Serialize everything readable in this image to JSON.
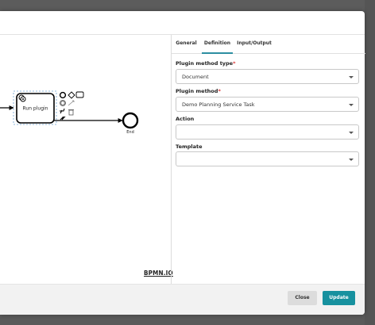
{
  "tabs": [
    {
      "label": "General"
    },
    {
      "label": "Definition",
      "active": true
    },
    {
      "label": "Input/Output"
    }
  ],
  "form": {
    "plugin_method_type": {
      "label": "Plugin method type",
      "required_mark": "*",
      "value": "Document"
    },
    "plugin_method": {
      "label": "Plugin method",
      "required_mark": "*",
      "value": "Demo Planning Service Task"
    },
    "action": {
      "label": "Action",
      "value": ""
    },
    "template": {
      "label": "Template",
      "value": ""
    }
  },
  "diagram": {
    "task_label": "Run plugin",
    "end_event_label": "End",
    "watermark": "BPMN.IO"
  },
  "footer": {
    "close_label": "Close",
    "update_label": "Update"
  },
  "colors": {
    "accent": "#17919f",
    "tab_underline": "#2c8ea1",
    "required": "#dd3333"
  }
}
